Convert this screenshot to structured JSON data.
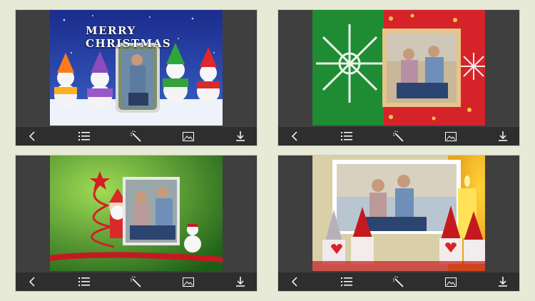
{
  "cards": [
    {
      "id": "frame-1",
      "title_text": "MERRY CHRISTMAS",
      "theme": "snowmen"
    },
    {
      "id": "frame-2",
      "title_text": "",
      "theme": "snowflakes"
    },
    {
      "id": "frame-3",
      "title_text": "",
      "theme": "santa-tree"
    },
    {
      "id": "frame-4",
      "title_text": "",
      "theme": "gnomes-candle"
    }
  ],
  "toolbar_icons": [
    "back-icon",
    "list-icon",
    "magic-wand-icon",
    "image-icon",
    "download-icon"
  ],
  "colors": {
    "page_bg": "#e6ead7",
    "panel_bg": "#3f3f3f",
    "toolbar_bg": "#2e2e2e",
    "icon": "#ffffff"
  }
}
